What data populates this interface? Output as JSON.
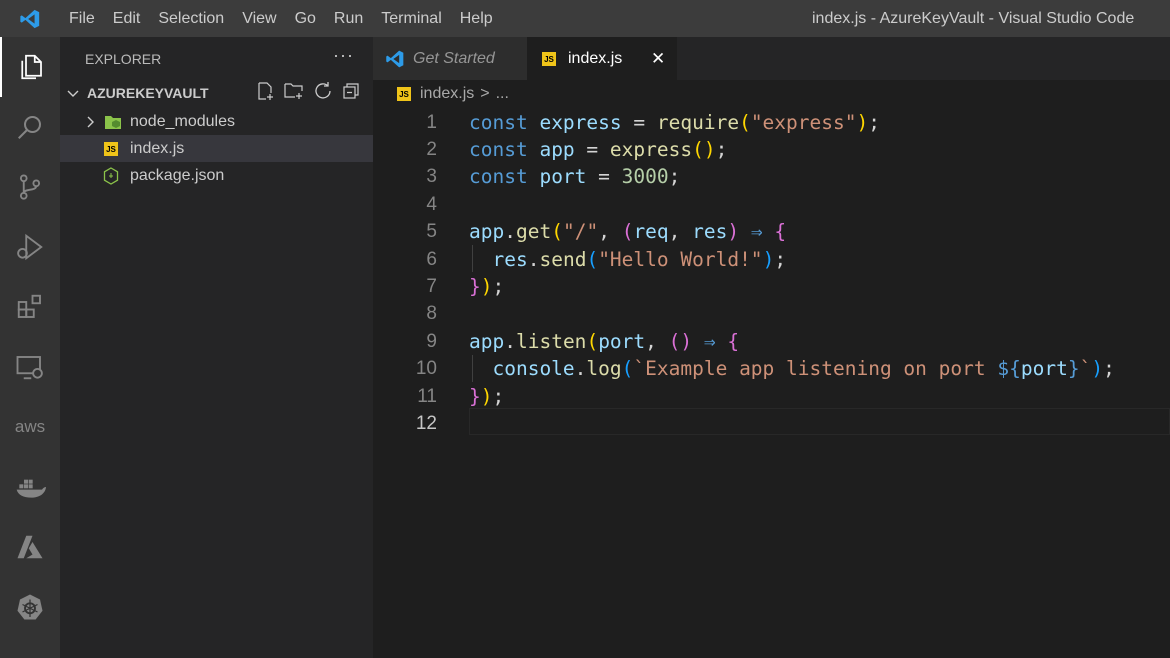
{
  "window": {
    "title": "index.js - AzureKeyVault - Visual Studio Code"
  },
  "menu": [
    "File",
    "Edit",
    "Selection",
    "View",
    "Go",
    "Run",
    "Terminal",
    "Help"
  ],
  "activity_bar": [
    "explorer-icon",
    "search-icon",
    "source-control-icon",
    "run-debug-icon",
    "extensions-icon",
    "remote-explorer-icon",
    "aws-icon",
    "docker-icon",
    "azure-icon",
    "kubernetes-icon"
  ],
  "aws_label": "aws",
  "sidebar": {
    "header": "EXPLORER",
    "more": "···",
    "folder": "AZUREKEYVAULT",
    "items": [
      {
        "label": "node_modules",
        "type": "folder"
      },
      {
        "label": "index.js",
        "type": "js",
        "selected": true
      },
      {
        "label": "package.json",
        "type": "json"
      }
    ]
  },
  "tabs": [
    {
      "label": "Get Started",
      "active": false
    },
    {
      "label": "index.js",
      "active": true,
      "close": "✕"
    }
  ],
  "breadcrumb": {
    "file": "index.js",
    "separator": ">",
    "rest": "..."
  },
  "js_badge": "JS",
  "editor": {
    "current_line": 12,
    "lines": [
      [
        [
          "k",
          "const"
        ],
        [
          "w",
          " "
        ],
        [
          "v",
          "express"
        ],
        [
          "w",
          " = "
        ],
        [
          "f",
          "require"
        ],
        [
          "p1",
          "("
        ],
        [
          "s",
          "\"express\""
        ],
        [
          "p1",
          ")"
        ],
        [
          "w",
          ";"
        ]
      ],
      [
        [
          "k",
          "const"
        ],
        [
          "w",
          " "
        ],
        [
          "v",
          "app"
        ],
        [
          "w",
          " = "
        ],
        [
          "f",
          "express"
        ],
        [
          "p1",
          "()"
        ],
        [
          "w",
          ";"
        ]
      ],
      [
        [
          "k",
          "const"
        ],
        [
          "w",
          " "
        ],
        [
          "v",
          "port"
        ],
        [
          "w",
          " = "
        ],
        [
          "n",
          "3000"
        ],
        [
          "w",
          ";"
        ]
      ],
      [],
      [
        [
          "v",
          "app"
        ],
        [
          "w",
          "."
        ],
        [
          "f",
          "get"
        ],
        [
          "p1",
          "("
        ],
        [
          "s",
          "\"/\""
        ],
        [
          "w",
          ", "
        ],
        [
          "p2",
          "("
        ],
        [
          "v",
          "req"
        ],
        [
          "w",
          ", "
        ],
        [
          "v",
          "res"
        ],
        [
          "p2",
          ")"
        ],
        [
          "w",
          " "
        ],
        [
          "k",
          "⇒"
        ],
        [
          "w",
          " "
        ],
        [
          "p2",
          "{"
        ]
      ],
      [
        [
          "w",
          "  "
        ],
        [
          "v",
          "res"
        ],
        [
          "w",
          "."
        ],
        [
          "f",
          "send"
        ],
        [
          "p3",
          "("
        ],
        [
          "s",
          "\"Hello World!\""
        ],
        [
          "p3",
          ")"
        ],
        [
          "w",
          ";"
        ]
      ],
      [
        [
          "p2",
          "}"
        ],
        [
          "p1",
          ")"
        ],
        [
          "w",
          ";"
        ]
      ],
      [],
      [
        [
          "v",
          "app"
        ],
        [
          "w",
          "."
        ],
        [
          "f",
          "listen"
        ],
        [
          "p1",
          "("
        ],
        [
          "v",
          "port"
        ],
        [
          "w",
          ", "
        ],
        [
          "p2",
          "()"
        ],
        [
          "w",
          " "
        ],
        [
          "k",
          "⇒"
        ],
        [
          "w",
          " "
        ],
        [
          "p2",
          "{"
        ]
      ],
      [
        [
          "w",
          "  "
        ],
        [
          "v",
          "console"
        ],
        [
          "w",
          "."
        ],
        [
          "f",
          "log"
        ],
        [
          "p3",
          "("
        ],
        [
          "s",
          "`Example app listening on port "
        ],
        [
          "k",
          "${"
        ],
        [
          "v",
          "port"
        ],
        [
          "k",
          "}"
        ],
        [
          "s",
          "`"
        ],
        [
          "p3",
          ")"
        ],
        [
          "w",
          ";"
        ]
      ],
      [
        [
          "p2",
          "}"
        ],
        [
          "p1",
          ")"
        ],
        [
          "w",
          ";"
        ]
      ],
      []
    ]
  }
}
